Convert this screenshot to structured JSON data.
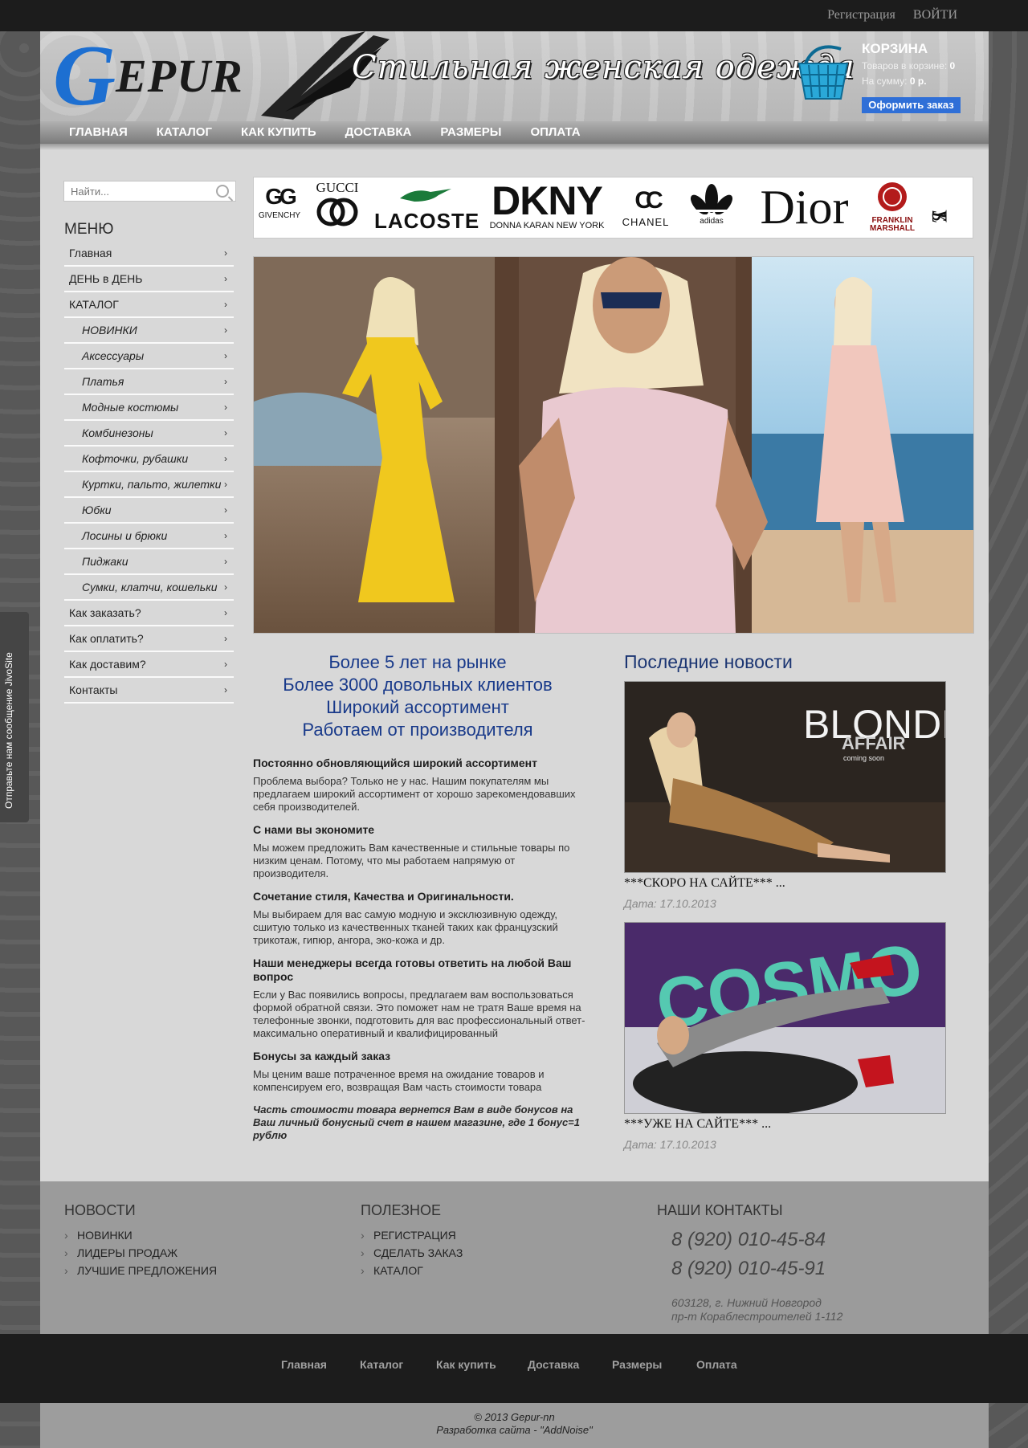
{
  "topbar": {
    "register": "Регистрация",
    "login": "ВОЙТИ"
  },
  "header": {
    "logo_initial": "G",
    "logo_rest": "EPUR",
    "slogan": "Стильная женская одежда",
    "cart": {
      "title": "КОРЗИНА",
      "items_label": "Товаров в корзине:",
      "items_value": "0",
      "sum_label": "На сумму:",
      "sum_value": "0 р.",
      "order_button": "Оформить заказ"
    }
  },
  "nav": [
    "ГЛАВНАЯ",
    "КАТАЛОГ",
    "КАК КУПИТЬ",
    "ДОСТАВКА",
    "РАЗМЕРЫ",
    "ОПЛАТА"
  ],
  "search": {
    "placeholder": "Найти..."
  },
  "menu": {
    "title": "МЕНЮ",
    "items": [
      {
        "label": "Главная",
        "sub": false
      },
      {
        "label": "ДЕНЬ в ДЕНЬ",
        "sub": false
      },
      {
        "label": "КАТАЛОГ",
        "sub": false
      },
      {
        "label": "НОВИНКИ",
        "sub": true
      },
      {
        "label": "Аксессуары",
        "sub": true
      },
      {
        "label": "Платья",
        "sub": true
      },
      {
        "label": "Модные костюмы",
        "sub": true
      },
      {
        "label": "Комбинезоны",
        "sub": true
      },
      {
        "label": "Кофточки, рубашки",
        "sub": true
      },
      {
        "label": "Куртки, пальто, жилетки",
        "sub": true
      },
      {
        "label": "Юбки",
        "sub": true
      },
      {
        "label": "Лосины и брюки",
        "sub": true
      },
      {
        "label": "Пиджаки",
        "sub": true
      },
      {
        "label": "Сумки, клатчи, кошельки",
        "sub": true
      },
      {
        "label": "Как заказать?",
        "sub": false
      },
      {
        "label": "Как оплатить?",
        "sub": false
      },
      {
        "label": "Как доставим?",
        "sub": false
      },
      {
        "label": "Контакты",
        "sub": false
      }
    ]
  },
  "brands": {
    "givenchy_mark": "GG",
    "givenchy": "GIVENCHY",
    "gucci": "GUCCI",
    "lacoste": "LACOSTE",
    "dkny": "DKNY",
    "donna_karan": "DONNA KARAN NEW YORK",
    "chanel_mark": "CC",
    "chanel": "CHANEL",
    "adidas": "adidas",
    "dior": "Dior",
    "franklin": "FRANKLIN",
    "marshall": "MARSHALL",
    "ysl": "YSL"
  },
  "taglines": [
    "Более 5 лет на рынке",
    "Более 3000 довольных клиентов",
    "Широкий ассортимент",
    "Работаем от производителя"
  ],
  "features": [
    {
      "title": "Постоянно обновляющийся широкий ассортимент",
      "text": "Проблема выбора? Только не у нас. Нашим покупателям мы предлагаем широкий ассортимент от хорошо зарекомендовавших себя производителей."
    },
    {
      "title": "С нами вы экономите",
      "text": "Мы можем предложить Вам качественные и стильные товары по низким ценам. Потому, что мы работаем напрямую от производителя."
    },
    {
      "title": "Сочетание стиля, Качества и Оригинальности.",
      "text": "Мы выбираем для вас самую модную и эксклюзивную одежду, сшитую только из качественных тканей таких как французский трикотаж, гипюр, ангора, эко-кожа и др."
    },
    {
      "title": "Наши менеджеры всегда готовы ответить на любой Ваш вопрос",
      "text": "Если у Вас появились вопросы, предлагаем вам воспользоваться формой обратной связи. Это поможет нам не тратя Ваше время на телефонные звонки, подготовить для вас профессиональный ответ-максимально оперативный и квалифицированный"
    },
    {
      "title": "Бонусы за каждый заказ",
      "text": "Мы ценим ваше потраченное время на ожидание товаров и компенсируем его, возвращая Вам часть стоимости товара"
    }
  ],
  "bonus_note": "Часть стоимости товара вернется Вам в виде бонусов на Ваш личный бонусный счет в нашем магазине, где 1 бонус=1 рублю",
  "news": {
    "title": "Последние новости",
    "items": [
      {
        "image_text_1": "BLONDE",
        "image_text_2": "AFFAIR",
        "image_text_3": "coming soon",
        "caption": "***СКОРО НА САЙТЕ*** ...",
        "date": "Дата: 17.10.2013"
      },
      {
        "image_text_1": "COSMO",
        "image_text_2": "",
        "caption": "***УЖЕ НА САЙТЕ*** ...",
        "date": "Дата: 17.10.2013"
      }
    ]
  },
  "footer": {
    "col1": {
      "title": "НОВОСТИ",
      "links": [
        "НОВИНКИ",
        "ЛИДЕРЫ ПРОДАЖ",
        "ЛУЧШИЕ ПРЕДЛОЖЕНИЯ"
      ]
    },
    "col2": {
      "title": "ПОЛЕЗНОЕ",
      "links": [
        "РЕГИСТРАЦИЯ",
        "СДЕЛАТЬ ЗАКАЗ",
        "КАТАЛОГ"
      ]
    },
    "col3": {
      "title": "НАШИ КОНТАКТЫ",
      "phone1": "8 (920) 010-45-84",
      "phone2": "8 (920) 010-45-91",
      "address1": "603128, г. Нижний Новгород",
      "address2": "пр-т Кораблестроителей 1-112"
    }
  },
  "bottom_nav": [
    "Главная",
    "Каталог",
    "Как купить",
    "Доставка",
    "Размеры",
    "Оплата"
  ],
  "copyright": {
    "line1": "© 2013 Gepur-nn",
    "line2": "Разработка сайта - \"AddNoise\""
  },
  "jivo": {
    "label": "Отправьте нам сообщение JivoSite"
  },
  "colors": {
    "accent": "#1d6fd1",
    "tagline": "#193a8a",
    "order_button": "#2f6fd7"
  }
}
